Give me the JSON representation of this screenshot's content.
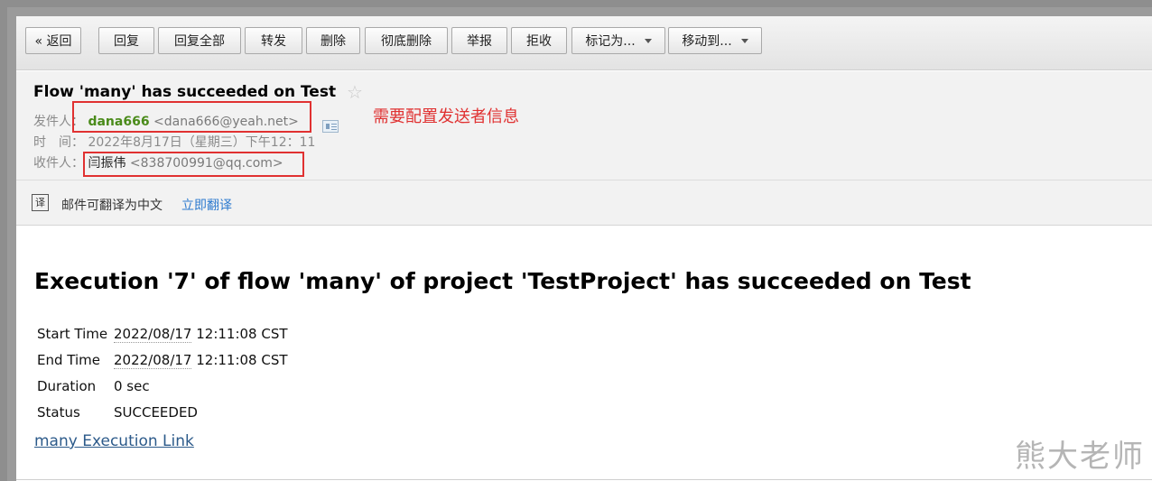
{
  "toolbar": {
    "back": "« 返回",
    "reply": "回复",
    "reply_all": "回复全部",
    "forward": "转发",
    "delete": "删除",
    "delete_permanently": "彻底删除",
    "report": "举报",
    "reject": "拒收",
    "mark_as": "标记为...",
    "move_to": "移动到..."
  },
  "header": {
    "subject": "Flow 'many' has succeeded on Test",
    "star": "☆",
    "sender_label": "发件人：",
    "sender_name": "dana666",
    "sender_email": "<dana666@yeah.net>",
    "time_label": "时　间：",
    "time_value": "2022年8月17日（星期三）下午12：11",
    "recipient_label": "收件人：",
    "recipient_name": "闫振伟",
    "recipient_email": "<838700991@qq.com>",
    "annotation": "需要配置发送者信息"
  },
  "translate": {
    "icon_text": "译",
    "text": "邮件可翻译为中文",
    "link": "立即翻译"
  },
  "body": {
    "title": "Execution '7' of flow 'many' of project 'TestProject' has succeeded on Test",
    "rows": [
      {
        "label": "Start Time",
        "value": "2022/08/17",
        "value2": " 12:11:08 CST"
      },
      {
        "label": "End Time",
        "value": "2022/08/17",
        "value2": " 12:11:08 CST"
      },
      {
        "label": "Duration",
        "value": "0 sec",
        "value2": ""
      },
      {
        "label": "Status",
        "value": "SUCCEEDED",
        "value2": ""
      }
    ],
    "link": "many Execution Link"
  },
  "watermark": "熊大老师",
  "colors": {
    "annotation_red": "#e03131",
    "sender_green": "#4a8b1a",
    "link_blue": "#2e7bcf"
  }
}
